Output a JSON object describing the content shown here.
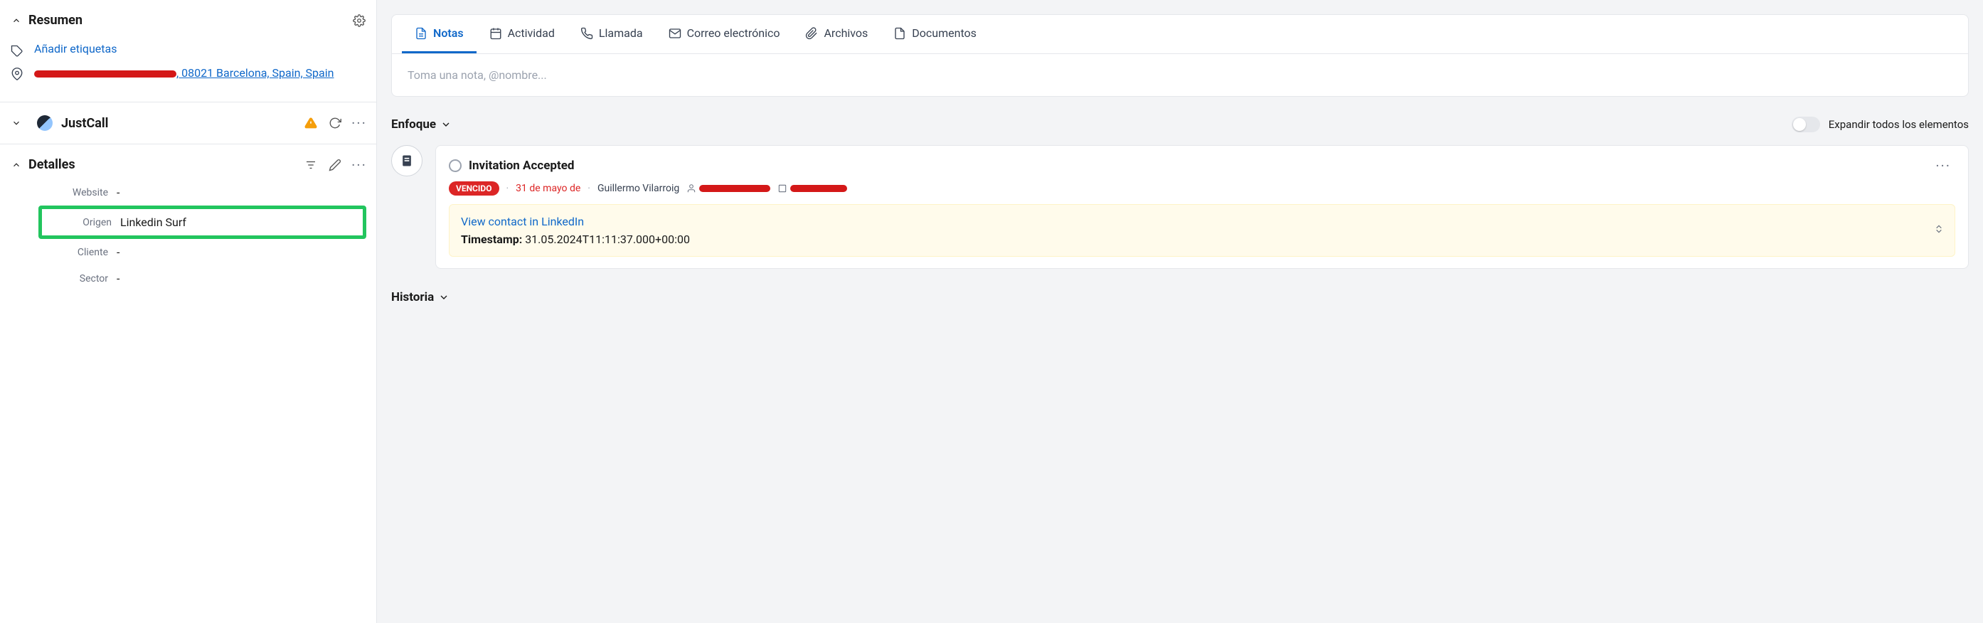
{
  "left": {
    "summary": {
      "title": "Resumen",
      "tags_link": "Añadir etiquetas",
      "address_suffix": ", 08021 Barcelona, Spain, Spain"
    },
    "justcall": {
      "title": "JustCall"
    },
    "details": {
      "title": "Detalles",
      "rows": {
        "website_label": "Website",
        "website_value": "-",
        "origen_label": "Origen",
        "origen_value": "Linkedin Surf",
        "cliente_label": "Cliente",
        "cliente_value": "-",
        "sector_label": "Sector",
        "sector_value": "-"
      }
    }
  },
  "right": {
    "tabs": {
      "notas": "Notas",
      "actividad": "Actividad",
      "llamada": "Llamada",
      "correo": "Correo electrónico",
      "archivos": "Archivos",
      "documentos": "Documentos"
    },
    "note_placeholder": "Toma una nota, @nombre...",
    "focus": {
      "title": "Enfoque",
      "toggle_label": "Expandir todos los elementos"
    },
    "task": {
      "title": "Invitation Accepted",
      "badge": "VENCIDO",
      "date": "31 de mayo de",
      "assignee": "Guillermo Vilarroig",
      "link": "View contact in LinkedIn",
      "timestamp_label": "Timestamp:",
      "timestamp_value": "31.05.2024T11:11:37.000+00:00"
    },
    "history": {
      "title": "Historia"
    }
  }
}
